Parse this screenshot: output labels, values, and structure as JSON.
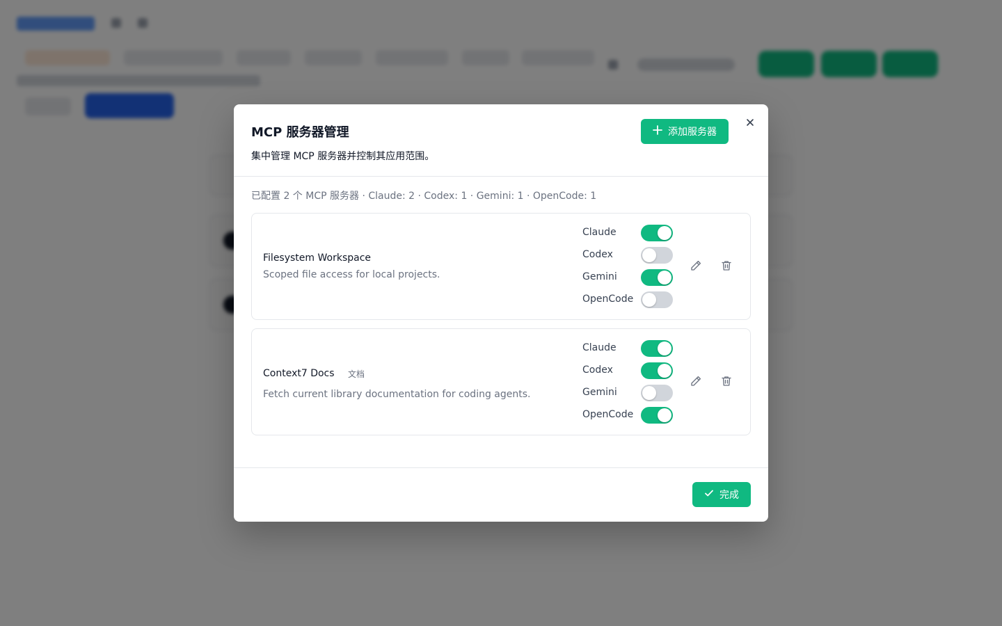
{
  "modal": {
    "title": "MCP 服务器管理",
    "description": "集中管理 MCP 服务器并控制其应用范围。",
    "add_button_label": "添加服务器",
    "done_button_label": "完成",
    "summary": "已配置 2 个 MCP 服务器 · Claude: 2 · Codex: 1 · Gemini: 1 · OpenCode: 1"
  },
  "servers": [
    {
      "name": "Filesystem Workspace",
      "description": "Scoped file access for local projects.",
      "apps": [
        {
          "label": "Claude",
          "enabled": true
        },
        {
          "label": "Codex",
          "enabled": false
        },
        {
          "label": "Gemini",
          "enabled": true
        },
        {
          "label": "OpenCode",
          "enabled": false
        }
      ]
    },
    {
      "name": "Context7 Docs",
      "tag": "文档",
      "description": "Fetch current library documentation for coding agents.",
      "apps": [
        {
          "label": "Claude",
          "enabled": true
        },
        {
          "label": "Codex",
          "enabled": true
        },
        {
          "label": "Gemini",
          "enabled": false
        },
        {
          "label": "OpenCode",
          "enabled": true
        }
      ]
    }
  ],
  "colors": {
    "accent": "#10b981",
    "toggle_off": "#d1d5db",
    "muted_text": "#6b7280",
    "overlay": "rgba(0,0,0,0.5)"
  },
  "icons": {
    "add": "plus-icon",
    "close": "close-icon",
    "edit": "pencil-icon",
    "delete": "trash-icon",
    "done": "check-icon"
  }
}
